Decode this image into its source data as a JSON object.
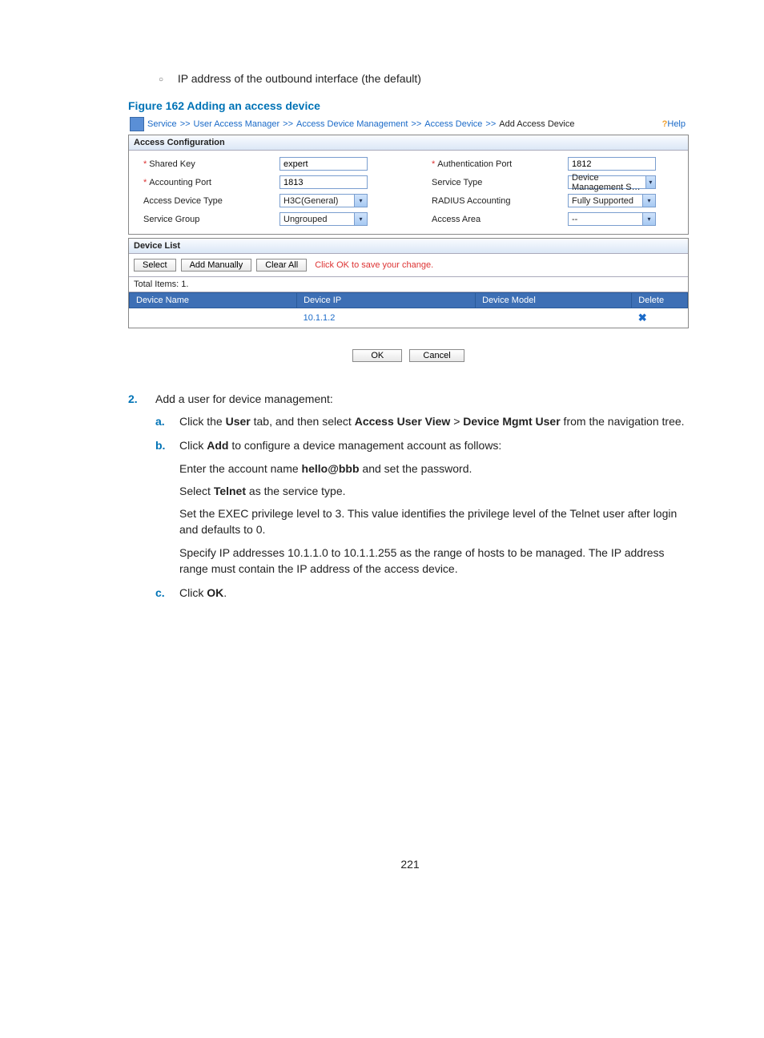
{
  "intro": {
    "bullet_line": "IP address of the outbound interface (the default)"
  },
  "figure": {
    "caption": "Figure 162 Adding an access device"
  },
  "screenshot": {
    "breadcrumbs": {
      "items": [
        "Service",
        "User Access Manager",
        "Access Device Management",
        "Access Device"
      ],
      "current": "Add Access Device",
      "sep": ">>"
    },
    "help_label": "Help",
    "access_config_title": "Access Configuration",
    "labels": {
      "shared_key": "Shared Key",
      "auth_port": "Authentication Port",
      "acct_port": "Accounting Port",
      "service_type": "Service Type",
      "access_dev_type": "Access Device Type",
      "radius_acct": "RADIUS Accounting",
      "service_group": "Service Group",
      "access_area": "Access Area"
    },
    "values": {
      "shared_key": "expert",
      "auth_port": "1812",
      "acct_port": "1813",
      "service_type": "Device Management S…",
      "access_dev_type": "H3C(General)",
      "radius_acct": "Fully Supported",
      "service_group": "Ungrouped",
      "access_area": "--"
    },
    "device_list": {
      "title": "Device List",
      "buttons": {
        "select": "Select",
        "add_manually": "Add Manually",
        "clear_all": "Clear All"
      },
      "hint": "Click OK to save your change.",
      "total_items": "Total Items: 1.",
      "headers": {
        "name": "Device Name",
        "ip": "Device IP",
        "model": "Device Model",
        "delete": "Delete"
      },
      "rows": [
        {
          "name": "",
          "ip": "10.1.1.2",
          "model": ""
        }
      ]
    },
    "footer_buttons": {
      "ok": "OK",
      "cancel": "Cancel"
    }
  },
  "steps": {
    "step2": {
      "num": "2.",
      "text": "Add a user for device management:",
      "a": {
        "lett": "a.",
        "pre": "Click the ",
        "b1": "User",
        "mid1": " tab, and then select ",
        "b2": "Access User View",
        "gt": " > ",
        "b3": "Device Mgmt User",
        "post": " from the navigation tree."
      },
      "b": {
        "lett": "b.",
        "pre": "Click ",
        "b1": "Add",
        "post": " to configure a device management account as follows:",
        "p1_pre": "Enter the account name ",
        "p1_b": "hello@bbb",
        "p1_post": " and set the password.",
        "p2_pre": "Select ",
        "p2_b": "Telnet",
        "p2_post": " as the service type.",
        "p3": "Set the EXEC privilege level to 3. This value identifies the privilege level of the Telnet user after login and defaults to 0.",
        "p4": "Specify IP addresses 10.1.1.0 to 10.1.1.255 as the range of hosts to be managed. The IP address range must contain the IP address of the access device."
      },
      "c": {
        "lett": "c.",
        "pre": "Click ",
        "b1": "OK",
        "post": "."
      }
    }
  },
  "page_number": "221"
}
